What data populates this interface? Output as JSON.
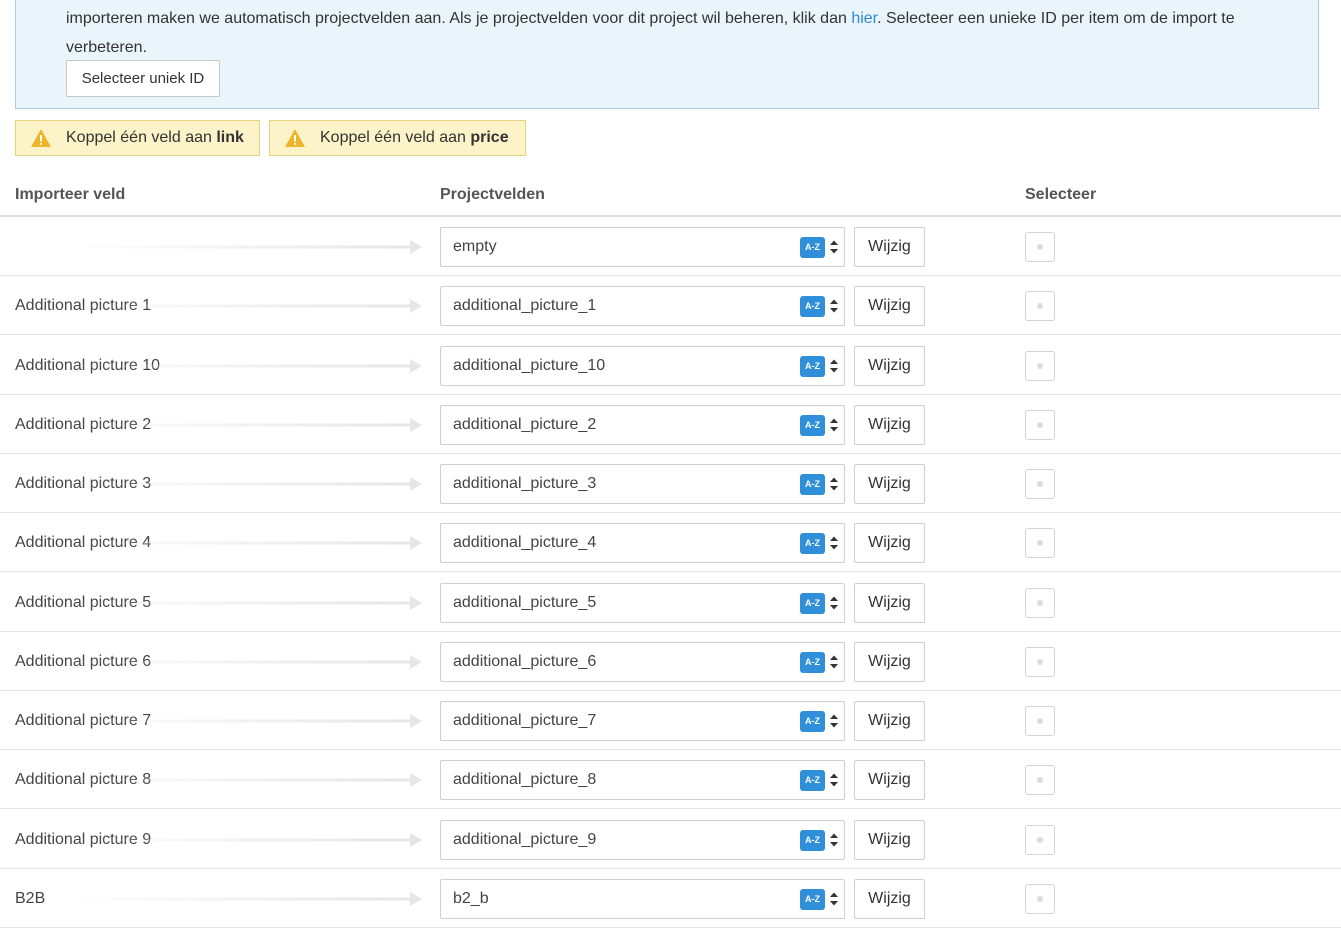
{
  "info": {
    "text_before_link": "importeren maken we automatisch projectvelden aan. Als je projectvelden voor dit project wil beheren, klik dan ",
    "link": "hier",
    "text_after_link": ". Selecteer een unieke ID per item om de import te verbeteren.",
    "button_label": "Selecteer uniek ID"
  },
  "warnings": [
    {
      "prefix": "Koppel één veld aan ",
      "field": "link"
    },
    {
      "prefix": "Koppel één veld aan ",
      "field": "price"
    }
  ],
  "table": {
    "headers": [
      "Importeer veld",
      "Projectvelden",
      "Selecteer"
    ],
    "az_badge": "A-Z",
    "change_label": "Wijzig",
    "rows": [
      {
        "import_field": "",
        "project_field": "empty"
      },
      {
        "import_field": "Additional picture 1",
        "project_field": "additional_picture_1"
      },
      {
        "import_field": "Additional picture 10",
        "project_field": "additional_picture_10"
      },
      {
        "import_field": "Additional picture 2",
        "project_field": "additional_picture_2"
      },
      {
        "import_field": "Additional picture 3",
        "project_field": "additional_picture_3"
      },
      {
        "import_field": "Additional picture 4",
        "project_field": "additional_picture_4"
      },
      {
        "import_field": "Additional picture 5",
        "project_field": "additional_picture_5"
      },
      {
        "import_field": "Additional picture 6",
        "project_field": "additional_picture_6"
      },
      {
        "import_field": "Additional picture 7",
        "project_field": "additional_picture_7"
      },
      {
        "import_field": "Additional picture 8",
        "project_field": "additional_picture_8"
      },
      {
        "import_field": "Additional picture 9",
        "project_field": "additional_picture_9"
      },
      {
        "import_field": "B2B",
        "project_field": "b2_b"
      }
    ]
  },
  "colors": {
    "info_bg": "#eaf4fb",
    "link": "#2a8ad4",
    "warning_bg": "#fcf3c8",
    "warning_icon": "#f0b428",
    "az_badge": "#2f8fd8"
  }
}
